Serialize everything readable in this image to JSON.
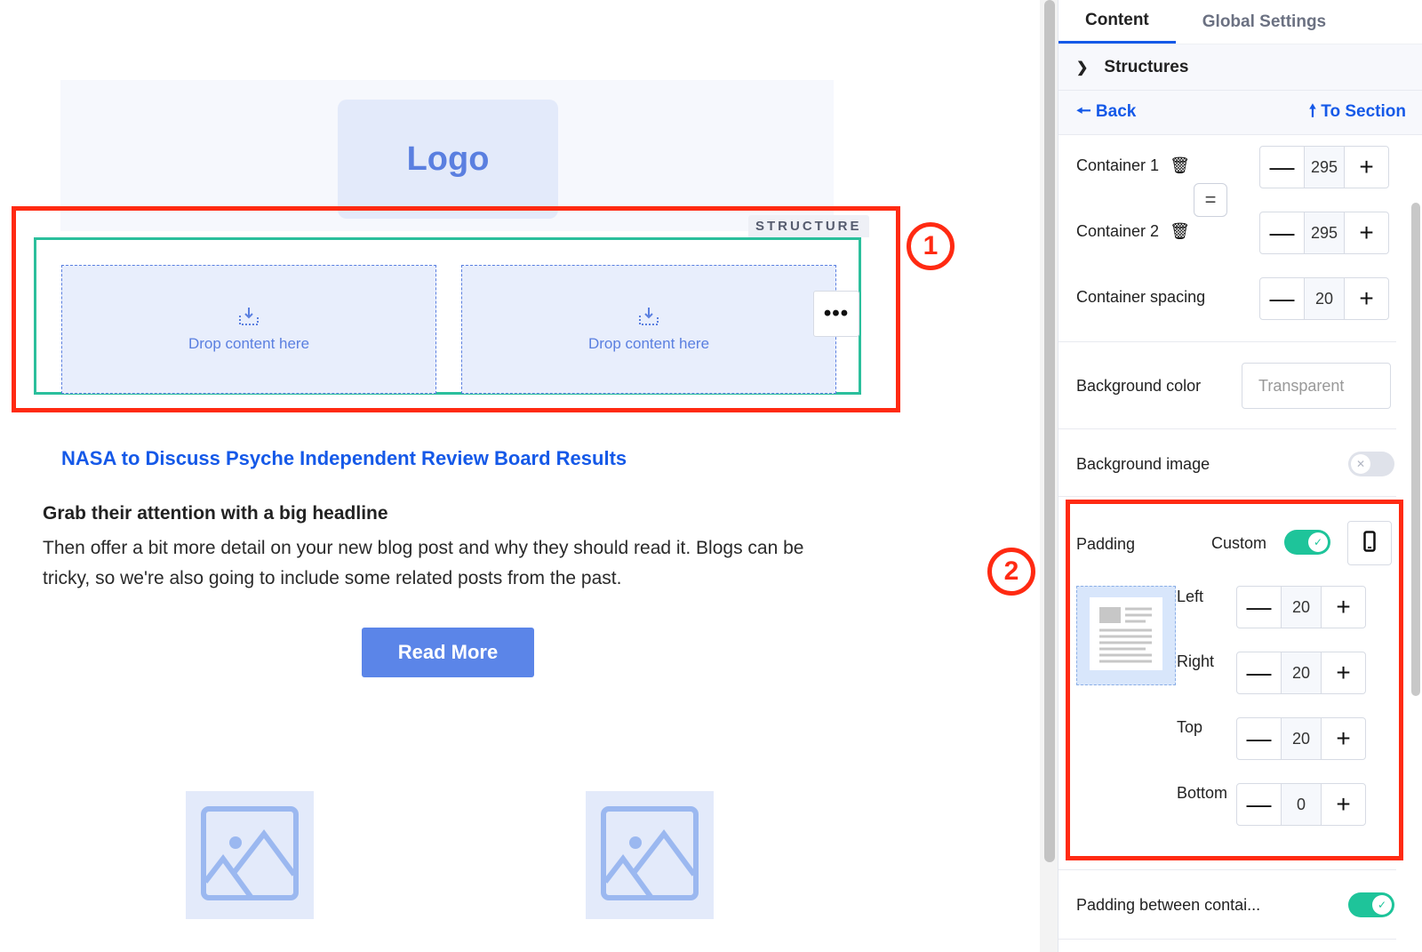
{
  "canvas": {
    "logo_text": "Logo",
    "structure_tag": "STRUCTURE",
    "dropzones": [
      {
        "label": "Drop content here",
        "icon": "drop-download-icon"
      },
      {
        "label": "Drop content here",
        "icon": "drop-download-icon"
      }
    ],
    "more_button": "•••",
    "headline_link": "NASA to Discuss Psyche Independent Review Board Results",
    "headline": "Grab their attention with a big headline",
    "body": "Then offer a bit more detail on your new blog post and why they should read it. Blogs can be tricky, so we're also going to include some related posts from the past.",
    "read_more_label": "Read More",
    "image_placeholders": [
      "image-icon",
      "image-icon"
    ]
  },
  "annotations": {
    "marker_1": "1",
    "marker_2": "2",
    "color": "#ff2a12"
  },
  "panel": {
    "tabs": [
      {
        "label": "Content",
        "active": true
      },
      {
        "label": "Global Settings",
        "active": false
      }
    ],
    "section_title": "Structures",
    "back_label": "Back",
    "to_section_label": "To Section",
    "containers": [
      {
        "label": "Container 1",
        "value": "295"
      },
      {
        "label": "Container 2",
        "value": "295"
      }
    ],
    "link_widths_symbol": "=",
    "container_spacing": {
      "label": "Container spacing",
      "value": "20"
    },
    "background_color": {
      "label": "Background color",
      "placeholder": "Transparent"
    },
    "background_image": {
      "label": "Background image",
      "enabled": false
    },
    "padding": {
      "label": "Padding",
      "custom_label": "Custom",
      "custom_enabled": true,
      "left": {
        "label": "Left",
        "value": "20"
      },
      "right": {
        "label": "Right",
        "value": "20"
      },
      "top": {
        "label": "Top",
        "value": "20"
      },
      "bottom": {
        "label": "Bottom",
        "value": "0"
      }
    },
    "padding_between": {
      "label": "Padding between contai...",
      "enabled": true
    },
    "stepper_minus": "—",
    "stepper_plus": "+"
  },
  "colors": {
    "accent_blue": "#1559e8",
    "structure_green": "#2bbf9c",
    "toggle_on": "#1ec49a",
    "button_blue": "#5b85e8"
  }
}
